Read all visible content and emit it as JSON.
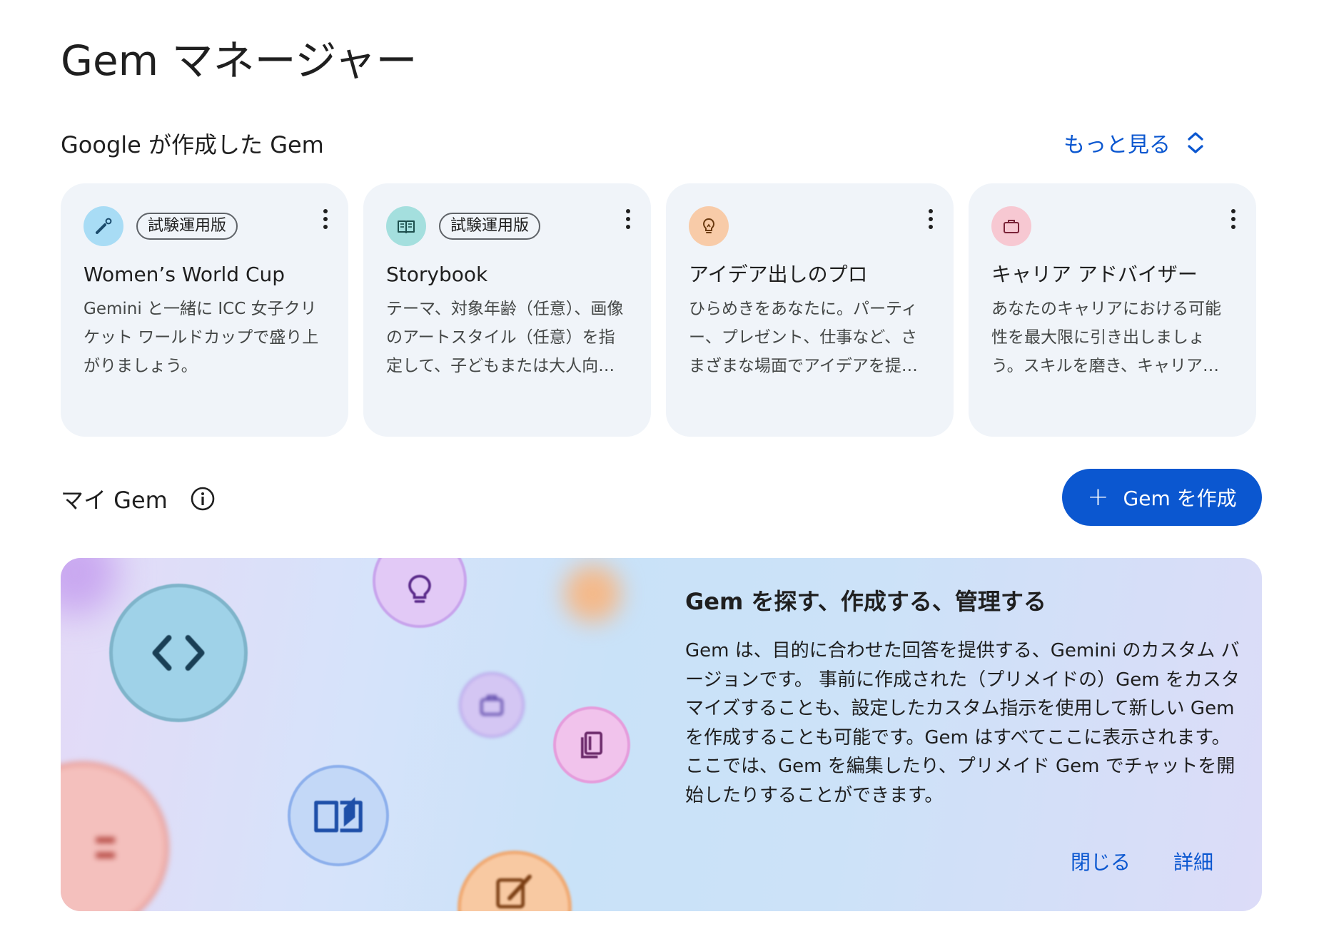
{
  "page": {
    "title": "Gem マネージャー"
  },
  "google_section": {
    "title": "Google が作成した Gem",
    "more_label": "もっと見る",
    "cards": [
      {
        "badge": "試験運用版",
        "title": "Women’s World Cup",
        "description": "Gemini と一緒に ICC 女子クリケット ワールドカップで盛り上がりましょう。",
        "icon": "cricket-icon",
        "icon_bg": "#a8dcf5"
      },
      {
        "badge": "試験運用版",
        "title": "Storybook",
        "description": "テーマ、対象年齢（任意）、画像のアートスタイル（任意）を指定して、子どもまたは大人向けの絵本を作成しましょう。",
        "icon": "book-icon",
        "icon_bg": "#a4dfde"
      },
      {
        "badge": "",
        "title": "アイデア出しのプロ",
        "description": "ひらめきをあなたに。パーティー、プレゼント、仕事など、さまざまな場面でアイデアを提案します。",
        "icon": "lightbulb-icon",
        "icon_bg": "#f8cba8"
      },
      {
        "badge": "",
        "title": "キャリア アドバイザー",
        "description": "あなたのキャリアにおける可能性を最大限に引き出しましょう。スキルを磨き、キャリアの目標を達成しましょう。",
        "icon": "briefcase-icon",
        "icon_bg": "#f7c8d2"
      }
    ]
  },
  "my_gem": {
    "title": "マイ Gem",
    "create_label": "Gem を作成",
    "create_plus": "+"
  },
  "banner": {
    "heading": "Gem を探す、作成する、管理する",
    "body": "Gem は、目的に合わせた回答を提供する、Gemini のカスタム バージョンです。 事前に作成された（プリメイドの）Gem をカスタマイズすることも、設定したカスタム指示を使用して新しい Gem を作成することも可能です。Gem はすべてここに表示されます。ここでは、Gem を編集したり、プリメイド Gem でチャットを開始したりすることができます。",
    "close_label": "閉じる",
    "details_label": "詳細"
  },
  "colors": {
    "accent": "#0b57d0",
    "card_bg": "#f0f4f9"
  }
}
